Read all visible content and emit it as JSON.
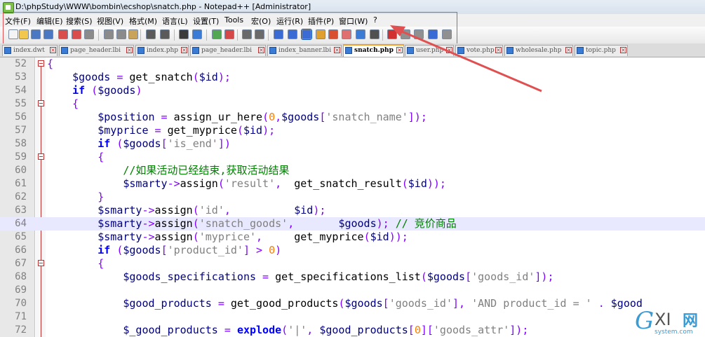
{
  "window": {
    "title": "D:\\phpStudy\\WWW\\bombin\\ecshop\\snatch.php - Notepad++ [Administrator]"
  },
  "menu": [
    "文件(F)",
    "编辑(E)",
    "搜索(S)",
    "视图(V)",
    "格式(M)",
    "语言(L)",
    "设置(T)",
    "Tools",
    "宏(O)",
    "运行(R)",
    "插件(P)",
    "窗口(W)",
    "?"
  ],
  "tabs": [
    {
      "label": "index.dwt"
    },
    {
      "label": "page_header.lbi"
    },
    {
      "label": "index.php"
    },
    {
      "label": "page_header.lbi"
    },
    {
      "label": "index_banner.lbi"
    },
    {
      "label": "snatch.php",
      "active": true
    },
    {
      "label": "user.php"
    },
    {
      "label": "vote.php"
    },
    {
      "label": "wholesale.php"
    },
    {
      "label": "topic.php"
    }
  ],
  "colors": {
    "annotation": "#e05050",
    "current_line": "#e8e8ff"
  },
  "editor": {
    "current_line": "64",
    "lines": [
      {
        "n": "52",
        "fold": "open",
        "segs": [
          [
            "op",
            "{"
          ]
        ]
      },
      {
        "n": "53",
        "segs": [
          [
            "sp",
            "    "
          ],
          [
            "var",
            "$goods"
          ],
          [
            "op",
            " = "
          ],
          [
            "fn",
            "get_snatch"
          ],
          [
            "op",
            "("
          ],
          [
            "var",
            "$id"
          ],
          [
            "op",
            ");"
          ]
        ]
      },
      {
        "n": "54",
        "segs": [
          [
            "sp",
            "    "
          ],
          [
            "kw",
            "if"
          ],
          [
            "op",
            " ("
          ],
          [
            "var",
            "$goods"
          ],
          [
            "op",
            ")"
          ]
        ]
      },
      {
        "n": "55",
        "fold": "open",
        "segs": [
          [
            "sp",
            "    "
          ],
          [
            "op",
            "{"
          ]
        ]
      },
      {
        "n": "56",
        "segs": [
          [
            "sp",
            "        "
          ],
          [
            "var",
            "$position"
          ],
          [
            "op",
            " = "
          ],
          [
            "fn",
            "assign_ur_here"
          ],
          [
            "op",
            "("
          ],
          [
            "num",
            "0"
          ],
          [
            "op",
            ","
          ],
          [
            "var",
            "$goods"
          ],
          [
            "op",
            "["
          ],
          [
            "str",
            "'snatch_name'"
          ],
          [
            "op",
            "]);"
          ]
        ]
      },
      {
        "n": "57",
        "segs": [
          [
            "sp",
            "        "
          ],
          [
            "var",
            "$myprice"
          ],
          [
            "op",
            " = "
          ],
          [
            "fn",
            "get_myprice"
          ],
          [
            "op",
            "("
          ],
          [
            "var",
            "$id"
          ],
          [
            "op",
            ");"
          ]
        ]
      },
      {
        "n": "58",
        "segs": [
          [
            "sp",
            "        "
          ],
          [
            "kw",
            "if"
          ],
          [
            "op",
            " ("
          ],
          [
            "var",
            "$goods"
          ],
          [
            "op",
            "["
          ],
          [
            "str",
            "'is_end'"
          ],
          [
            "op",
            "])"
          ]
        ]
      },
      {
        "n": "59",
        "fold": "open",
        "segs": [
          [
            "sp",
            "        "
          ],
          [
            "op",
            "{"
          ]
        ]
      },
      {
        "n": "60",
        "segs": [
          [
            "sp",
            "            "
          ],
          [
            "cmt",
            "//如果活动已经结束,获取活动结果"
          ]
        ]
      },
      {
        "n": "61",
        "segs": [
          [
            "sp",
            "            "
          ],
          [
            "var",
            "$smarty"
          ],
          [
            "op",
            "->"
          ],
          [
            "fn",
            "assign"
          ],
          [
            "op",
            "("
          ],
          [
            "str",
            "'result'"
          ],
          [
            "op",
            ",  "
          ],
          [
            "fn",
            "get_snatch_result"
          ],
          [
            "op",
            "("
          ],
          [
            "var",
            "$id"
          ],
          [
            "op",
            "));"
          ]
        ]
      },
      {
        "n": "62",
        "segs": [
          [
            "sp",
            "        "
          ],
          [
            "op",
            "}"
          ]
        ]
      },
      {
        "n": "63",
        "segs": [
          [
            "sp",
            "        "
          ],
          [
            "var",
            "$smarty"
          ],
          [
            "op",
            "->"
          ],
          [
            "fn",
            "assign"
          ],
          [
            "op",
            "("
          ],
          [
            "str",
            "'id'"
          ],
          [
            "op",
            ",          "
          ],
          [
            "var",
            "$id"
          ],
          [
            "op",
            ");"
          ]
        ]
      },
      {
        "n": "64",
        "segs": [
          [
            "sp",
            "        "
          ],
          [
            "var",
            "$smarty"
          ],
          [
            "op",
            "->"
          ],
          [
            "fn",
            "assign"
          ],
          [
            "op",
            "("
          ],
          [
            "str",
            "'snatch_goods'"
          ],
          [
            "op",
            ",       "
          ],
          [
            "var",
            "$goods"
          ],
          [
            "op",
            "); "
          ],
          [
            "cmt",
            "// 竞价商品"
          ]
        ]
      },
      {
        "n": "65",
        "segs": [
          [
            "sp",
            "        "
          ],
          [
            "var",
            "$smarty"
          ],
          [
            "op",
            "->"
          ],
          [
            "fn",
            "assign"
          ],
          [
            "op",
            "("
          ],
          [
            "str",
            "'myprice'"
          ],
          [
            "op",
            ",     "
          ],
          [
            "fn",
            "get_myprice"
          ],
          [
            "op",
            "("
          ],
          [
            "var",
            "$id"
          ],
          [
            "op",
            "));"
          ]
        ]
      },
      {
        "n": "66",
        "segs": [
          [
            "sp",
            "        "
          ],
          [
            "kw",
            "if"
          ],
          [
            "op",
            " ("
          ],
          [
            "var",
            "$goods"
          ],
          [
            "op",
            "["
          ],
          [
            "str",
            "'product_id'"
          ],
          [
            "op",
            "] > "
          ],
          [
            "num",
            "0"
          ],
          [
            "op",
            ")"
          ]
        ]
      },
      {
        "n": "67",
        "fold": "open",
        "segs": [
          [
            "sp",
            "        "
          ],
          [
            "op",
            "{"
          ]
        ]
      },
      {
        "n": "68",
        "segs": [
          [
            "sp",
            "            "
          ],
          [
            "var",
            "$goods_specifications"
          ],
          [
            "op",
            " = "
          ],
          [
            "fn",
            "get_specifications_list"
          ],
          [
            "op",
            "("
          ],
          [
            "var",
            "$goods"
          ],
          [
            "op",
            "["
          ],
          [
            "str",
            "'goods_id'"
          ],
          [
            "op",
            "]);"
          ]
        ]
      },
      {
        "n": "69",
        "segs": []
      },
      {
        "n": "70",
        "segs": [
          [
            "sp",
            "            "
          ],
          [
            "var",
            "$good_products"
          ],
          [
            "op",
            " = "
          ],
          [
            "fn",
            "get_good_products"
          ],
          [
            "op",
            "("
          ],
          [
            "var",
            "$goods"
          ],
          [
            "op",
            "["
          ],
          [
            "str",
            "'goods_id'"
          ],
          [
            "op",
            "], "
          ],
          [
            "str",
            "'AND product_id = '"
          ],
          [
            "op",
            " . "
          ],
          [
            "var",
            "$good"
          ]
        ]
      },
      {
        "n": "71",
        "segs": []
      },
      {
        "n": "72",
        "segs": [
          [
            "sp",
            "            "
          ],
          [
            "var",
            "$_good_products"
          ],
          [
            "op",
            " = "
          ],
          [
            "kw",
            "explode"
          ],
          [
            "op",
            "("
          ],
          [
            "str",
            "'|'"
          ],
          [
            "op",
            ", "
          ],
          [
            "var",
            "$good_products"
          ],
          [
            "op",
            "["
          ],
          [
            "num",
            "0"
          ],
          [
            "op",
            "]["
          ],
          [
            "str",
            "'goods_attr'"
          ],
          [
            "op",
            "]);"
          ]
        ]
      }
    ]
  },
  "watermark": {
    "g": "G",
    "xi": "XI",
    "cn": "网",
    "url": "system.com"
  }
}
